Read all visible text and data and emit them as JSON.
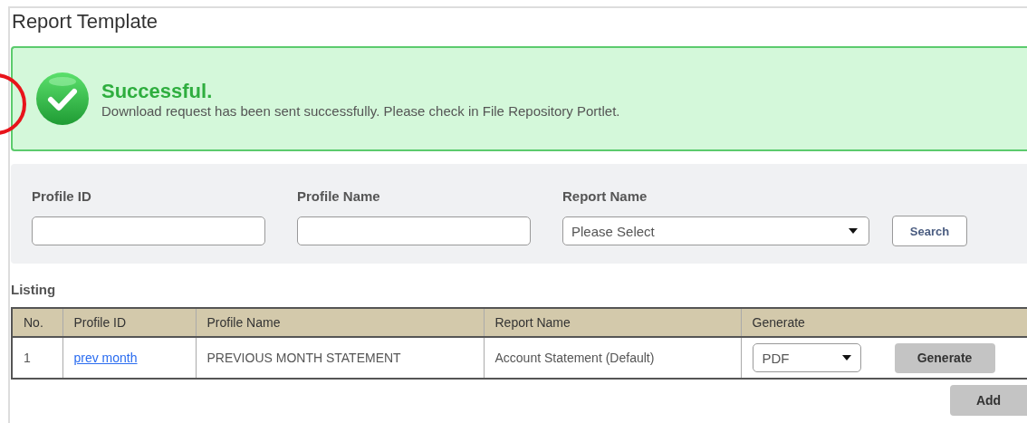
{
  "page": {
    "title": "Report Template"
  },
  "alert": {
    "kind": "success",
    "heading": "Successful.",
    "message": "Download request has been sent successfully. Please check in File Repository Portlet."
  },
  "filters": [
    {
      "kind": "text",
      "label": "Profile ID"
    },
    {
      "kind": "text",
      "label": "Profile Name"
    },
    {
      "kind": "select",
      "label": "Report Name",
      "value": "Please Select"
    }
  ],
  "search_button": "Search",
  "listing": {
    "title": "Listing",
    "columns": [
      "No.",
      "Profile ID",
      "Profile Name",
      "Report Name",
      "Generate"
    ],
    "rows": [
      {
        "no": "1",
        "profile_id": "prev month",
        "profile_name": "PREVIOUS MONTH STATEMENT",
        "report_name": "Account Statement (Default)",
        "format": "PDF",
        "generate_button": "Generate"
      }
    ]
  },
  "add_button": "Add"
}
